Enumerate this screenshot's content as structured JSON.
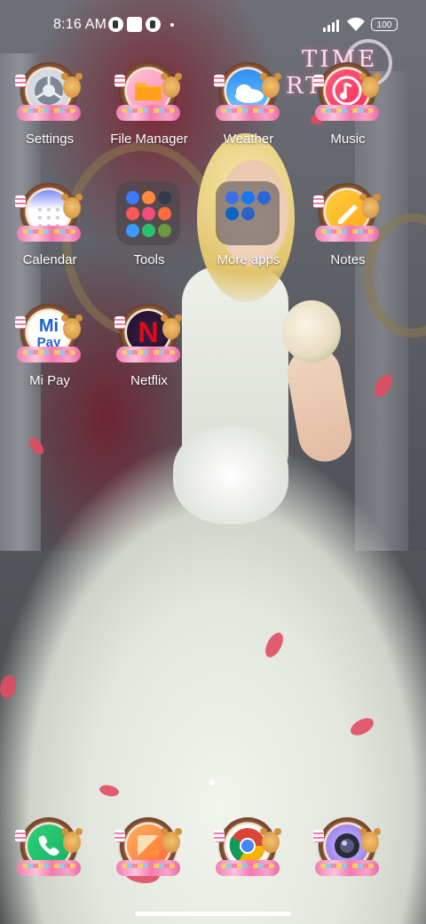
{
  "status_bar": {
    "time": "8:16 AM",
    "battery": "100",
    "icons": [
      "notification-badge-icon",
      "square-notification-icon",
      "notification-badge-icon",
      "dot-icon",
      "signal-icon",
      "wifi-icon",
      "battery-icon"
    ]
  },
  "wallpaper": {
    "logo_line1": "TIME",
    "logo_line2": "RTIE"
  },
  "home": {
    "rows": [
      [
        {
          "label": "Settings",
          "icon": "settings-gear-icon"
        },
        {
          "label": "File Manager",
          "icon": "folder-icon"
        },
        {
          "label": "Weather",
          "icon": "weather-cloud-icon"
        },
        {
          "label": "Music",
          "icon": "music-note-icon"
        }
      ],
      [
        {
          "label": "Calendar",
          "icon": "calendar-grid-icon"
        },
        {
          "label": "Tools",
          "icon": "folder-tools-icon"
        },
        {
          "label": "More apps",
          "icon": "folder-more-apps-icon"
        },
        {
          "label": "Notes",
          "icon": "notes-pencil-icon"
        }
      ],
      [
        {
          "label": "Mi Pay",
          "icon": "mi-pay-icon"
        },
        {
          "label": "Netflix",
          "icon": "netflix-icon"
        }
      ]
    ],
    "mipay_text1": "Mi",
    "mipay_text2": "Pay",
    "netflix_text": "N"
  },
  "dock": [
    {
      "label": "Phone",
      "icon": "phone-icon"
    },
    {
      "label": "Gallery",
      "icon": "gallery-icon"
    },
    {
      "label": "Chrome",
      "icon": "chrome-icon"
    },
    {
      "label": "Camera",
      "icon": "camera-icon"
    }
  ],
  "colors": {
    "ribbon_pink": "#f07fb3",
    "frame_brown": "#8e5a3a",
    "folder_bg": "#46464b"
  }
}
